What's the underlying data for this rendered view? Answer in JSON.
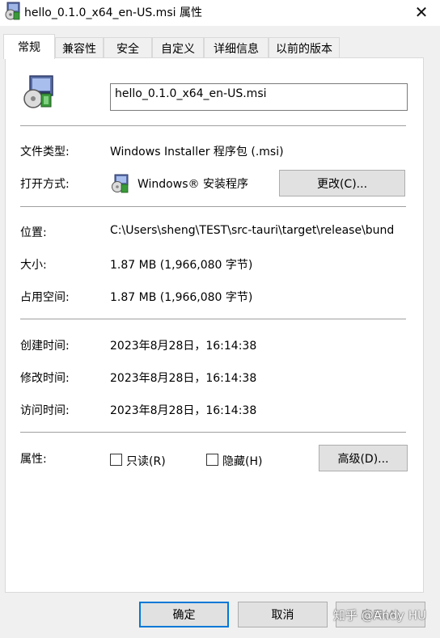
{
  "window": {
    "title": "hello_0.1.0_x64_en-US.msi 属性",
    "close_glyph": "✕"
  },
  "tabs": [
    {
      "label": "常规",
      "active": true
    },
    {
      "label": "兼容性"
    },
    {
      "label": "安全"
    },
    {
      "label": "自定义"
    },
    {
      "label": "详细信息"
    },
    {
      "label": "以前的版本"
    }
  ],
  "general": {
    "filename": "hello_0.1.0_x64_en-US.msi",
    "file_type_label": "文件类型:",
    "file_type_value": "Windows Installer 程序包 (.msi)",
    "open_with_label": "打开方式:",
    "open_with_value": "Windows® 安装程序",
    "change_button": "更改(C)...",
    "location_label": "位置:",
    "location_value": "C:\\Users\\sheng\\TEST\\src-tauri\\target\\release\\bund",
    "size_label": "大小:",
    "size_value": "1.87 MB (1,966,080 字节)",
    "size_on_disk_label": "占用空间:",
    "size_on_disk_value": "1.87 MB (1,966,080 字节)",
    "created_label": "创建时间:",
    "created_value": "2023年8月28日，16:14:38",
    "modified_label": "修改时间:",
    "modified_value": "2023年8月28日，16:14:38",
    "accessed_label": "访问时间:",
    "accessed_value": "2023年8月28日，16:14:38",
    "attributes_label": "属性:",
    "readonly_label": "只读(R)",
    "readonly_checked": false,
    "hidden_label": "隐藏(H)",
    "hidden_checked": false,
    "advanced_button": "高级(D)..."
  },
  "footer": {
    "ok_button": "确定",
    "cancel_button": "取消",
    "apply_button": "应用(A)"
  },
  "watermark": "知乎 @Andy HU",
  "icons": {
    "installer": "msi-installer-icon",
    "close": "close-icon"
  },
  "colors": {
    "accent": "#0078d7",
    "panel_bg": "#ffffff",
    "window_bg": "#f0f0f0"
  }
}
